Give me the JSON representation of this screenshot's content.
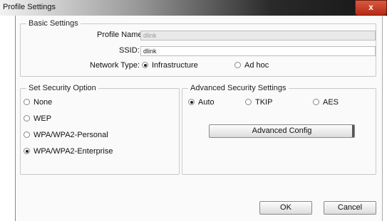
{
  "window": {
    "title": "Profile Settings",
    "close_glyph": "x"
  },
  "basic_settings": {
    "legend": "Basic Settings",
    "profile_name": {
      "label": "Profile Name:",
      "value": "dlink"
    },
    "ssid": {
      "label": "SSID:",
      "value": "dlink"
    },
    "network_type": {
      "label": "Network Type:",
      "options": [
        "Infrastructure",
        "Ad hoc"
      ],
      "selected": "Infrastructure"
    }
  },
  "security_option": {
    "legend": "Set Security Option",
    "options": [
      "None",
      "WEP",
      "WPA/WPA2-Personal",
      "WPA/WPA2-Enterprise"
    ],
    "selected": "WPA/WPA2-Enterprise"
  },
  "advanced_security": {
    "legend": "Advanced Security Settings",
    "options": [
      "Auto",
      "TKIP",
      "AES"
    ],
    "selected": "Auto",
    "config_button": "Advanced Config"
  },
  "footer": {
    "ok_label": "OK",
    "cancel_label": "Cancel"
  }
}
